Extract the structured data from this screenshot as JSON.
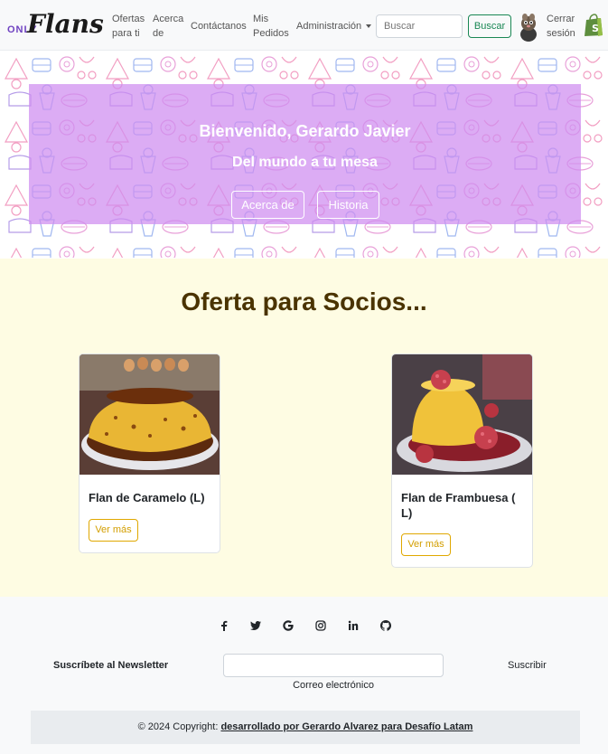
{
  "navbar": {
    "brand_only": "ONLY",
    "brand_flans": "Flans",
    "links": [
      {
        "line1": "Ofertas",
        "line2": "para ti"
      },
      {
        "line1": "Acerca",
        "line2": "de"
      },
      {
        "line1": "Contáctanos",
        "line2": ""
      },
      {
        "line1": "Mis",
        "line2": "Pedidos"
      }
    ],
    "admin_label": "Administración",
    "search_placeholder": "Buscar",
    "search_button": "Buscar",
    "logout_line1": "Cerrar",
    "logout_line2": "sesión"
  },
  "hero": {
    "title": "Bienvenido, Gerardo Javier",
    "subtitle": "Del mundo a tu mesa",
    "btn_about": "Acerca de",
    "btn_history": "Historia"
  },
  "offers": {
    "title": "Oferta para Socios...",
    "cards": [
      {
        "title": "Flan de Caramelo (L)",
        "button": "Ver más"
      },
      {
        "title": "Flan de Frambuesa ( L)",
        "button": "Ver más"
      }
    ]
  },
  "footer": {
    "social_icons": [
      "facebook-icon",
      "twitter-icon",
      "google-icon",
      "instagram-icon",
      "linkedin-icon",
      "github-icon"
    ],
    "newsletter_label": "Suscríbete al Newsletter",
    "newsletter_caption": "Correo electrónico",
    "subscribe_button": "Suscribir",
    "copyright_prefix": "© 2024 Copyright: ",
    "copyright_link": "desarrollado por Gerardo Alvarez para Desafío Latam"
  },
  "colors": {
    "hero_overlay": "#ce8cf0",
    "offers_bg": "#fefce3",
    "offers_title": "#4a3300",
    "accent_warning": "#e0a800",
    "accent_success": "#198754"
  }
}
